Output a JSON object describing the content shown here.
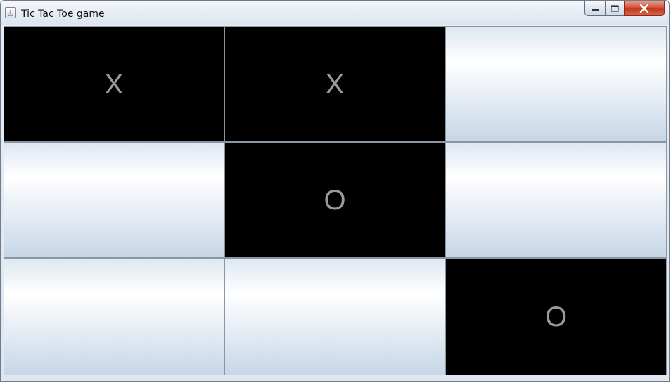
{
  "window": {
    "title": "Tic Tac Toe game",
    "buttons": {
      "minimize": "minimize-icon",
      "maximize": "maximize-icon",
      "close": "close-icon"
    }
  },
  "board": {
    "cells": [
      {
        "mark": "X",
        "state": "filled"
      },
      {
        "mark": "X",
        "state": "filled"
      },
      {
        "mark": "",
        "state": "empty"
      },
      {
        "mark": "",
        "state": "empty"
      },
      {
        "mark": "O",
        "state": "filled"
      },
      {
        "mark": "",
        "state": "empty"
      },
      {
        "mark": "",
        "state": "empty"
      },
      {
        "mark": "",
        "state": "empty"
      },
      {
        "mark": "O",
        "state": "filled"
      }
    ]
  },
  "colors": {
    "filled_cell": "#000000",
    "mark_text": "#9a9a9a",
    "close_button": "#c23a1f"
  }
}
